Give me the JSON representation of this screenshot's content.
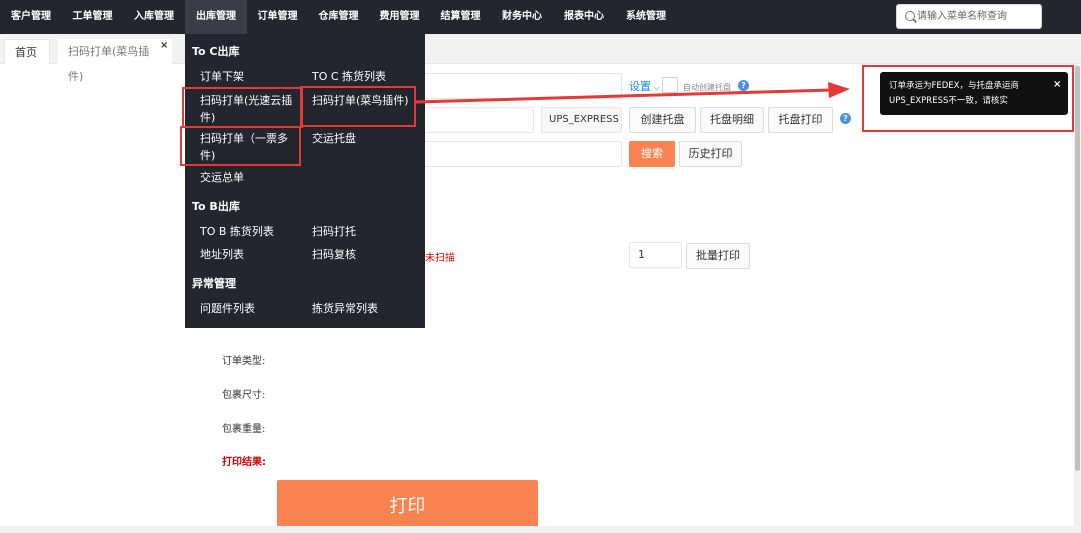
{
  "nav": {
    "items": [
      "客户管理",
      "工单管理",
      "入库管理",
      "出库管理",
      "订单管理",
      "仓库管理",
      "费用管理",
      "结算管理",
      "财务中心",
      "报表中心",
      "系统管理"
    ],
    "search_placeholder": "请输入菜单名称查询"
  },
  "tabs": {
    "home": "首页",
    "active": "扫码打单(菜鸟插件)",
    "close": "×"
  },
  "form": {
    "settings_link": "设置",
    "auto_create_label": "自动创建托盘",
    "carrier_value": "UPS_EXPRESS",
    "create_pallet": "创建托盘",
    "pallet_detail": "托盘明细",
    "pallet_print": "托盘打印",
    "search_button": "搜索",
    "history_print": "历史打印",
    "scan_status": "未扫描",
    "qty_value": "1",
    "batch_print": "批量打印",
    "order_type_label": "订单类型:",
    "package_size_label": "包裹尺寸:",
    "package_weight_label": "包裹重量:",
    "print_result_label": "打印结果:",
    "big_print_button": "打印"
  },
  "dropdown": {
    "sections": [
      {
        "title": "To C出库",
        "items": [
          "订单下架",
          "TO C 拣货列表",
          "扫码打单(光速云插件)",
          "扫码打单(菜鸟插件)",
          "扫码打单（一票多件)",
          "交运托盘",
          "交运总单"
        ]
      },
      {
        "title": "To B出库",
        "items": [
          "TO B 拣货列表",
          "扫码打托",
          "地址列表",
          "扫码复核"
        ]
      },
      {
        "title": "异常管理",
        "items": [
          "问题件列表",
          "拣货异常列表"
        ]
      }
    ]
  },
  "tooltip": {
    "message": "订单承运为FEDEX，与托盘承运商UPS_EXPRESS不一致，请核实",
    "close": "×"
  },
  "colors": {
    "nav_bg": "#23262e",
    "accent_orange": "#f98350",
    "highlight_red": "#e53935",
    "link_blue": "#1e88e5"
  }
}
